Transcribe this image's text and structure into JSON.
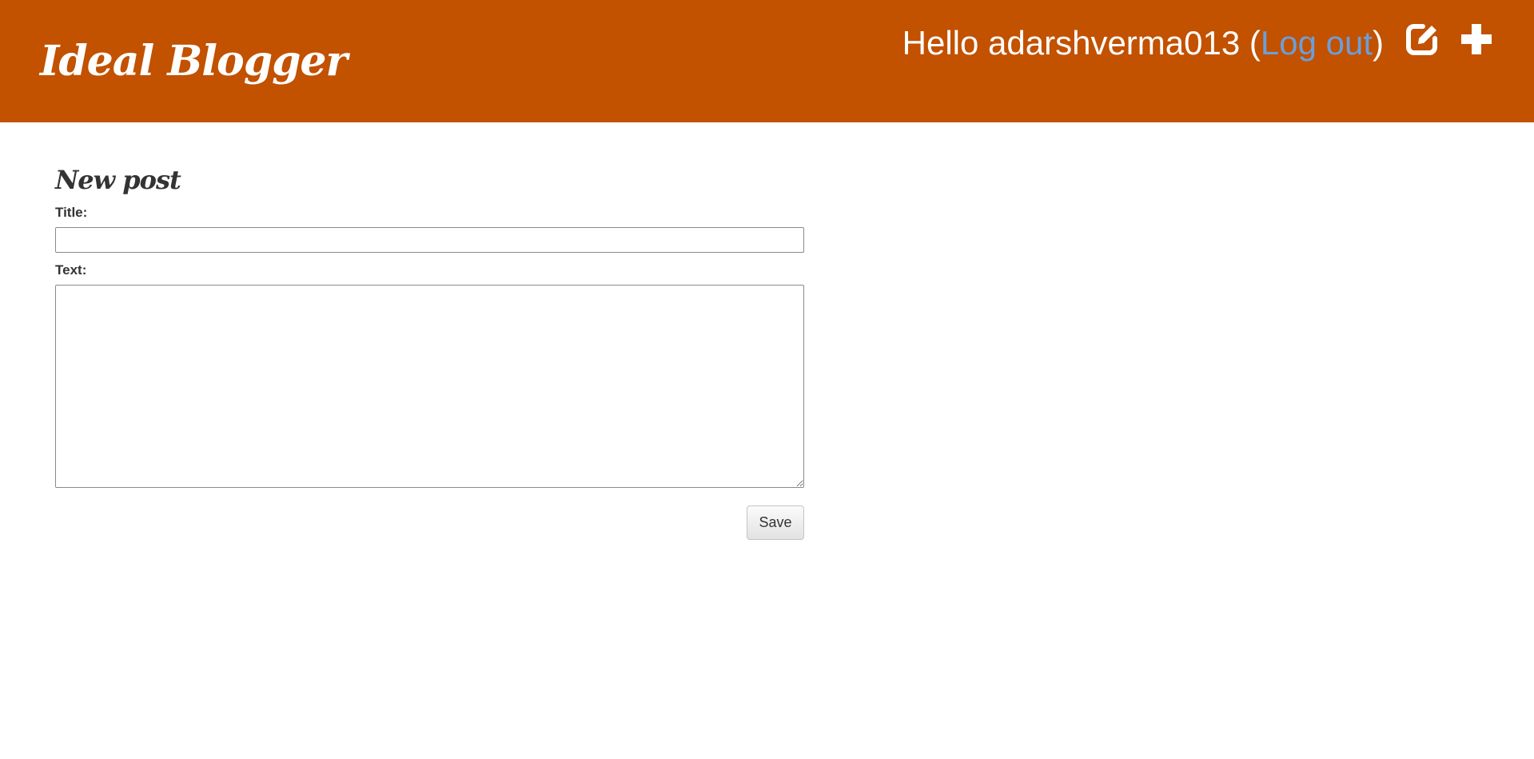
{
  "header": {
    "site_title": "Ideal Blogger",
    "greeting_prefix": "Hello adarshverma013 (",
    "logout_label": "Log out",
    "greeting_suffix": ")",
    "icons": [
      "edit-icon",
      "plus-icon"
    ],
    "background_color": "#c25100",
    "link_color": "#6d9ed8"
  },
  "form": {
    "heading": "New post",
    "title_label": "Title:",
    "title_value": "",
    "text_label": "Text:",
    "text_value": "",
    "save_label": "Save"
  }
}
